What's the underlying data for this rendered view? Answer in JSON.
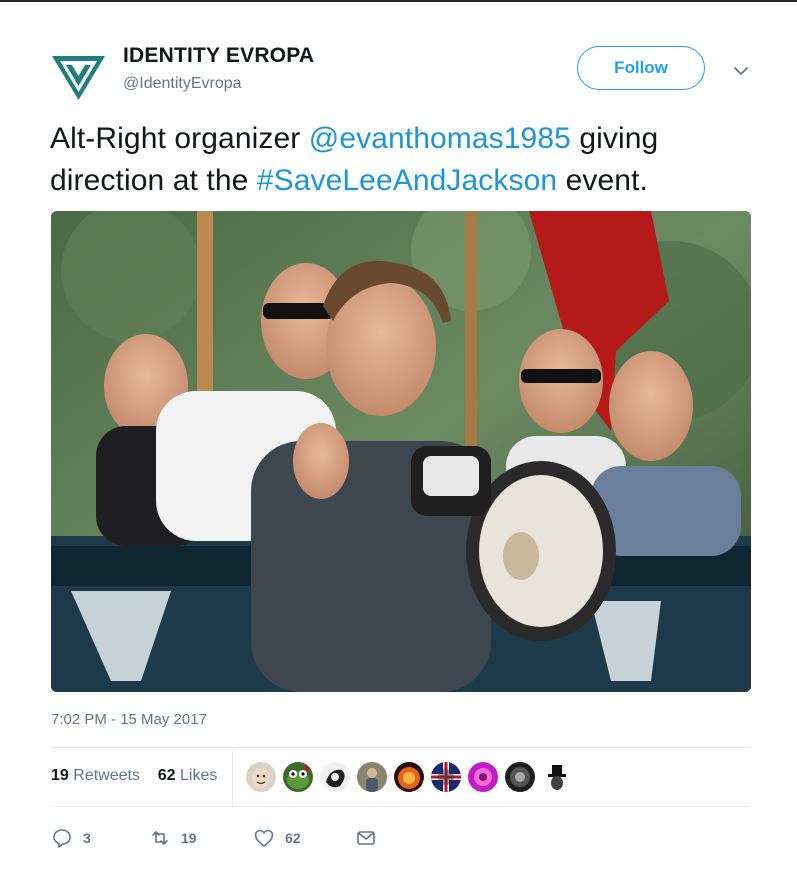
{
  "account": {
    "name": "IDENTITY EVROPA",
    "handle": "@IdentityEvropa",
    "follow_label": "Follow"
  },
  "tweet": {
    "text_1": "Alt-Right organizer ",
    "mention": "@evanthomas1985",
    "text_2": " giving direction at the ",
    "hashtag": "#SaveLeeAndJackson",
    "text_3": " event.",
    "timestamp": "7:02 PM - 15 May 2017"
  },
  "stats": {
    "retweets_count": "19",
    "retweets_label": "Retweets",
    "likes_count": "62",
    "likes_label": "Likes"
  },
  "actions": {
    "reply_count": "3",
    "retweet_count": "19",
    "like_count": "62"
  },
  "colors": {
    "accent": "#1da1f2",
    "link": "#1b95e0",
    "muted": "#657786",
    "logo": "#1f7f7e"
  }
}
